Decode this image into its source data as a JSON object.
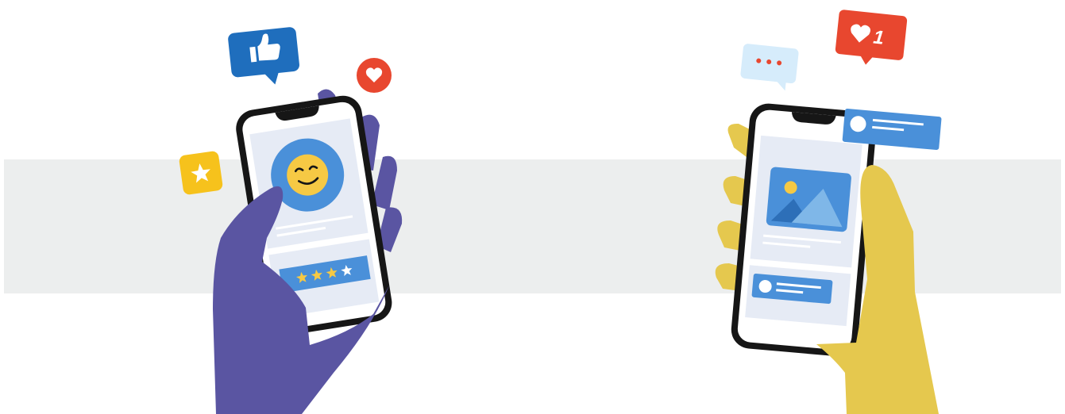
{
  "scene": {
    "background_band_color": "#eceeee",
    "left_phone": {
      "hand_color": "#5a55a2",
      "screen_bg": "#e6ebf5",
      "avatar_bg": "#4a90d9",
      "emoji_color": "#f6c944",
      "rating_bar_color": "#4a90d9",
      "rating": {
        "filled_stars": 3,
        "total_stars": 4
      },
      "icons": [
        "thumbs-up-icon",
        "heart-icon",
        "star-icon",
        "smiley-icon"
      ]
    },
    "right_phone": {
      "hand_color": "#e5c84e",
      "screen_bg": "#e6ebf5",
      "image_card_color": "#4a90d9",
      "notification_color": "#4a90d9",
      "like_badge": {
        "count": "1",
        "color": "#e8472f"
      },
      "typing_bubble_color": "#d6ecfb",
      "icons": [
        "heart-icon",
        "ellipsis-icon",
        "image-icon",
        "notification-icon"
      ]
    }
  }
}
